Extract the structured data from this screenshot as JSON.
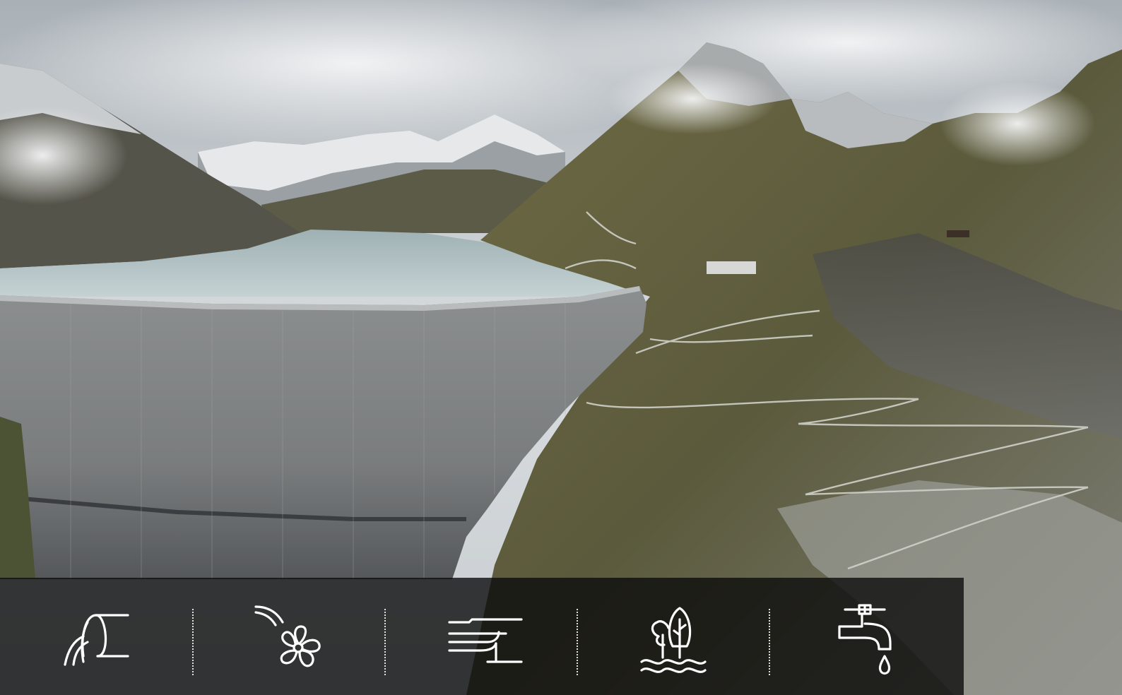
{
  "photo": {
    "subject": "mountain-dam-landscape"
  },
  "icon_bar": {
    "background": "#0c0c0c",
    "icon_color": "#ffffff",
    "icons": [
      {
        "name": "dam-water-outflow-icon"
      },
      {
        "name": "turbine-fan-icon"
      },
      {
        "name": "water-flow-channel-icon"
      },
      {
        "name": "trees-water-icon"
      },
      {
        "name": "water-tap-drop-icon"
      }
    ]
  }
}
